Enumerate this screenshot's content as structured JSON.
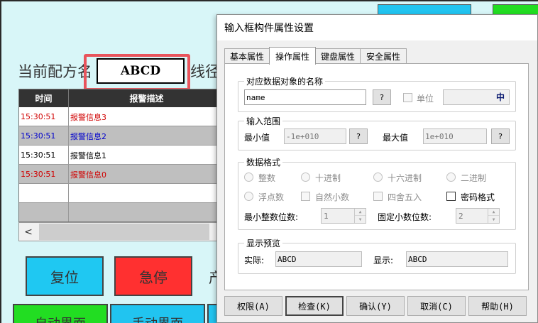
{
  "hmi": {
    "recipe_label": "当前配方名",
    "recipe_value": "ABCD",
    "line_label": "线径",
    "table": {
      "headers": [
        "时间",
        "报警描述"
      ],
      "rows": [
        {
          "time": "15:30:51",
          "desc": "报警信息3",
          "color": "#d00000"
        },
        {
          "time": "15:30:51",
          "desc": "报警信息2",
          "color": "#0000cc"
        },
        {
          "time": "15:30:51",
          "desc": "报警信息1",
          "color": "#000000"
        },
        {
          "time": "15:30:51",
          "desc": "报警信息0",
          "color": "#d00000"
        }
      ],
      "scroll_left": "<"
    },
    "reset_button": "复位",
    "estop_button": "急停",
    "partial_text": "产",
    "auto_button": "自动界面",
    "manual_button": "手动界面"
  },
  "dialog": {
    "title": "输入框构件属性设置",
    "tabs": [
      "基本属性",
      "操作属性",
      "键盘属性",
      "安全属性"
    ],
    "active_tab": "操作属性",
    "object_group": {
      "title": "对应数据对象的名称",
      "value": "name",
      "help": "?",
      "unit_label": "单位",
      "unit_value": "",
      "ime_icon": "中"
    },
    "range_group": {
      "title": "输入范围",
      "min_label": "最小值",
      "min_value": "-1e+010",
      "max_label": "最大值",
      "max_value": "1e+010",
      "help": "?"
    },
    "format_group": {
      "title": "数据格式",
      "options": {
        "integer": "整数",
        "decimal": "十进制",
        "hex": "十六进制",
        "binary": "二进制",
        "float": "浮点数",
        "natural": "自然小数",
        "round": "四舍五入",
        "password": "密码格式"
      },
      "min_int_label": "最小整数位数:",
      "min_int_value": "1",
      "fixed_dec_label": "固定小数位数:",
      "fixed_dec_value": "2"
    },
    "preview_group": {
      "title": "显示预览",
      "actual_label": "实际:",
      "actual_value": "ABCD",
      "display_label": "显示:",
      "display_value": "ABCD"
    },
    "buttons": {
      "permission": "权限(A)",
      "check": "检查(K)",
      "confirm": "确认(Y)",
      "cancel": "取消(C)",
      "help": "帮助(H)"
    }
  }
}
